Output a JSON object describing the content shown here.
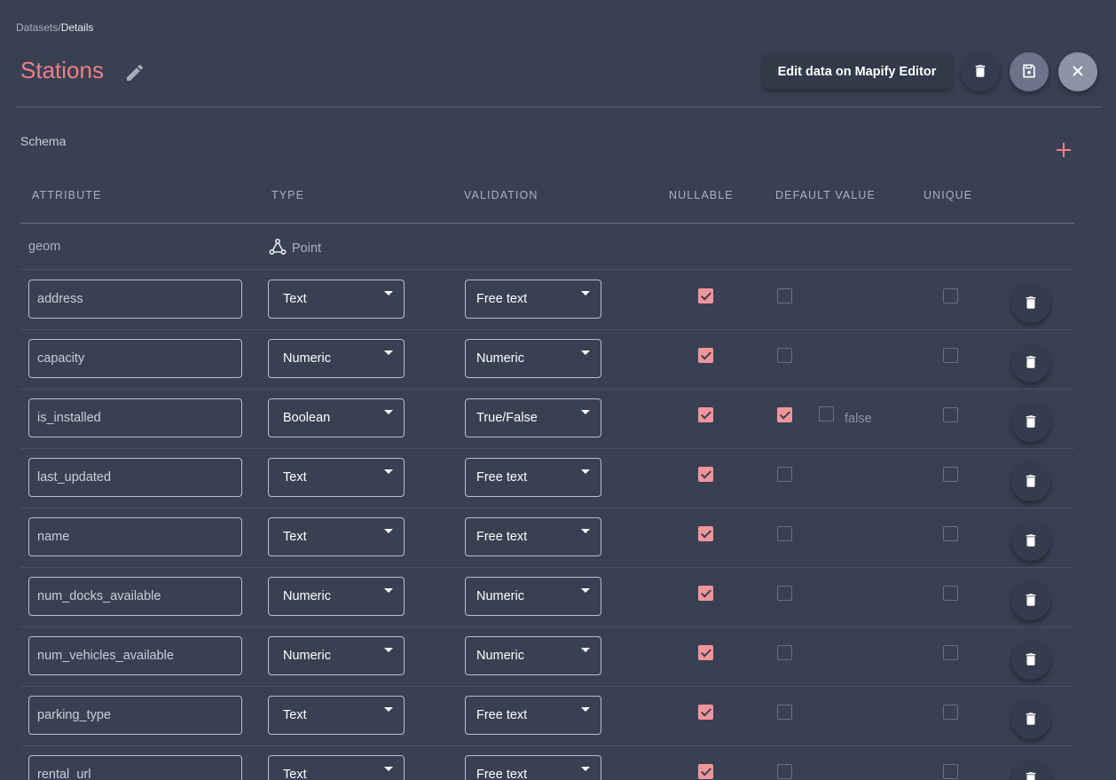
{
  "breadcrumb": {
    "parent": "Datasets",
    "separator": "/",
    "current": "Details"
  },
  "title": "Stations",
  "header": {
    "editor_button_label": "Edit data on Mapify Editor"
  },
  "schema": {
    "label": "Schema"
  },
  "columns": {
    "attribute": "ATTRIBUTE",
    "type": "TYPE",
    "validation": "VALIDATION",
    "nullable": "NULLABLE",
    "default_value": "DEFAULT VALUE",
    "unique": "UNIQUE"
  },
  "geom_row": {
    "name": "geom",
    "type": "Point",
    "type_icon": "point-geometry-icon"
  },
  "rows": [
    {
      "name": "address",
      "type": "Text",
      "validation": "Free text",
      "nullable": true,
      "default": false,
      "unique": false
    },
    {
      "name": "capacity",
      "type": "Numeric",
      "validation": "Numeric",
      "nullable": true,
      "default": false,
      "unique": false
    },
    {
      "name": "is_installed",
      "type": "Boolean",
      "validation": "True/False",
      "nullable": true,
      "default": true,
      "default_value_checked": false,
      "default_value_text": "false",
      "unique": false
    },
    {
      "name": "last_updated",
      "type": "Text",
      "validation": "Free text",
      "nullable": true,
      "default": false,
      "unique": false
    },
    {
      "name": "name",
      "type": "Text",
      "validation": "Free text",
      "nullable": true,
      "default": false,
      "unique": false
    },
    {
      "name": "num_docks_available",
      "type": "Numeric",
      "validation": "Numeric",
      "nullable": true,
      "default": false,
      "unique": false
    },
    {
      "name": "num_vehicles_available",
      "type": "Numeric",
      "validation": "Numeric",
      "nullable": true,
      "default": false,
      "unique": false
    },
    {
      "name": "parking_type",
      "type": "Text",
      "validation": "Free text",
      "nullable": true,
      "default": false,
      "unique": false
    },
    {
      "name": "rental_url",
      "type": "Text",
      "validation": "Free text",
      "nullable": true,
      "default": false,
      "unique": false
    }
  ],
  "colors": {
    "background": "#394052",
    "accent": "#f07f86",
    "checkbox_on": "#f2959b"
  }
}
